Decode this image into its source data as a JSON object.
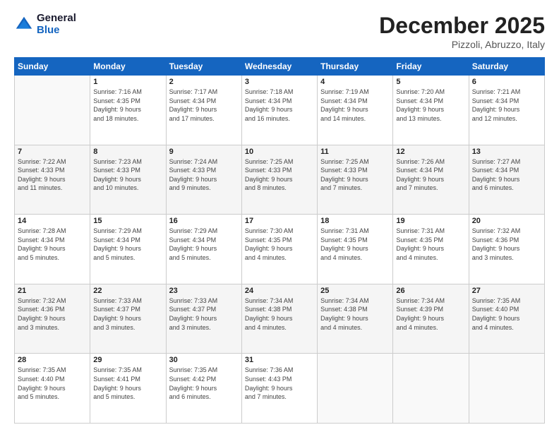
{
  "logo": {
    "line1": "General",
    "line2": "Blue"
  },
  "header": {
    "month": "December 2025",
    "location": "Pizzoli, Abruzzo, Italy"
  },
  "weekdays": [
    "Sunday",
    "Monday",
    "Tuesday",
    "Wednesday",
    "Thursday",
    "Friday",
    "Saturday"
  ],
  "weeks": [
    [
      {
        "day": "",
        "info": ""
      },
      {
        "day": "1",
        "info": "Sunrise: 7:16 AM\nSunset: 4:35 PM\nDaylight: 9 hours\nand 18 minutes."
      },
      {
        "day": "2",
        "info": "Sunrise: 7:17 AM\nSunset: 4:34 PM\nDaylight: 9 hours\nand 17 minutes."
      },
      {
        "day": "3",
        "info": "Sunrise: 7:18 AM\nSunset: 4:34 PM\nDaylight: 9 hours\nand 16 minutes."
      },
      {
        "day": "4",
        "info": "Sunrise: 7:19 AM\nSunset: 4:34 PM\nDaylight: 9 hours\nand 14 minutes."
      },
      {
        "day": "5",
        "info": "Sunrise: 7:20 AM\nSunset: 4:34 PM\nDaylight: 9 hours\nand 13 minutes."
      },
      {
        "day": "6",
        "info": "Sunrise: 7:21 AM\nSunset: 4:34 PM\nDaylight: 9 hours\nand 12 minutes."
      }
    ],
    [
      {
        "day": "7",
        "info": "Sunrise: 7:22 AM\nSunset: 4:33 PM\nDaylight: 9 hours\nand 11 minutes."
      },
      {
        "day": "8",
        "info": "Sunrise: 7:23 AM\nSunset: 4:33 PM\nDaylight: 9 hours\nand 10 minutes."
      },
      {
        "day": "9",
        "info": "Sunrise: 7:24 AM\nSunset: 4:33 PM\nDaylight: 9 hours\nand 9 minutes."
      },
      {
        "day": "10",
        "info": "Sunrise: 7:25 AM\nSunset: 4:33 PM\nDaylight: 9 hours\nand 8 minutes."
      },
      {
        "day": "11",
        "info": "Sunrise: 7:25 AM\nSunset: 4:33 PM\nDaylight: 9 hours\nand 7 minutes."
      },
      {
        "day": "12",
        "info": "Sunrise: 7:26 AM\nSunset: 4:34 PM\nDaylight: 9 hours\nand 7 minutes."
      },
      {
        "day": "13",
        "info": "Sunrise: 7:27 AM\nSunset: 4:34 PM\nDaylight: 9 hours\nand 6 minutes."
      }
    ],
    [
      {
        "day": "14",
        "info": "Sunrise: 7:28 AM\nSunset: 4:34 PM\nDaylight: 9 hours\nand 5 minutes."
      },
      {
        "day": "15",
        "info": "Sunrise: 7:29 AM\nSunset: 4:34 PM\nDaylight: 9 hours\nand 5 minutes."
      },
      {
        "day": "16",
        "info": "Sunrise: 7:29 AM\nSunset: 4:34 PM\nDaylight: 9 hours\nand 5 minutes."
      },
      {
        "day": "17",
        "info": "Sunrise: 7:30 AM\nSunset: 4:35 PM\nDaylight: 9 hours\nand 4 minutes."
      },
      {
        "day": "18",
        "info": "Sunrise: 7:31 AM\nSunset: 4:35 PM\nDaylight: 9 hours\nand 4 minutes."
      },
      {
        "day": "19",
        "info": "Sunrise: 7:31 AM\nSunset: 4:35 PM\nDaylight: 9 hours\nand 4 minutes."
      },
      {
        "day": "20",
        "info": "Sunrise: 7:32 AM\nSunset: 4:36 PM\nDaylight: 9 hours\nand 3 minutes."
      }
    ],
    [
      {
        "day": "21",
        "info": "Sunrise: 7:32 AM\nSunset: 4:36 PM\nDaylight: 9 hours\nand 3 minutes."
      },
      {
        "day": "22",
        "info": "Sunrise: 7:33 AM\nSunset: 4:37 PM\nDaylight: 9 hours\nand 3 minutes."
      },
      {
        "day": "23",
        "info": "Sunrise: 7:33 AM\nSunset: 4:37 PM\nDaylight: 9 hours\nand 3 minutes."
      },
      {
        "day": "24",
        "info": "Sunrise: 7:34 AM\nSunset: 4:38 PM\nDaylight: 9 hours\nand 4 minutes."
      },
      {
        "day": "25",
        "info": "Sunrise: 7:34 AM\nSunset: 4:38 PM\nDaylight: 9 hours\nand 4 minutes."
      },
      {
        "day": "26",
        "info": "Sunrise: 7:34 AM\nSunset: 4:39 PM\nDaylight: 9 hours\nand 4 minutes."
      },
      {
        "day": "27",
        "info": "Sunrise: 7:35 AM\nSunset: 4:40 PM\nDaylight: 9 hours\nand 4 minutes."
      }
    ],
    [
      {
        "day": "28",
        "info": "Sunrise: 7:35 AM\nSunset: 4:40 PM\nDaylight: 9 hours\nand 5 minutes."
      },
      {
        "day": "29",
        "info": "Sunrise: 7:35 AM\nSunset: 4:41 PM\nDaylight: 9 hours\nand 5 minutes."
      },
      {
        "day": "30",
        "info": "Sunrise: 7:35 AM\nSunset: 4:42 PM\nDaylight: 9 hours\nand 6 minutes."
      },
      {
        "day": "31",
        "info": "Sunrise: 7:36 AM\nSunset: 4:43 PM\nDaylight: 9 hours\nand 7 minutes."
      },
      {
        "day": "",
        "info": ""
      },
      {
        "day": "",
        "info": ""
      },
      {
        "day": "",
        "info": ""
      }
    ]
  ]
}
